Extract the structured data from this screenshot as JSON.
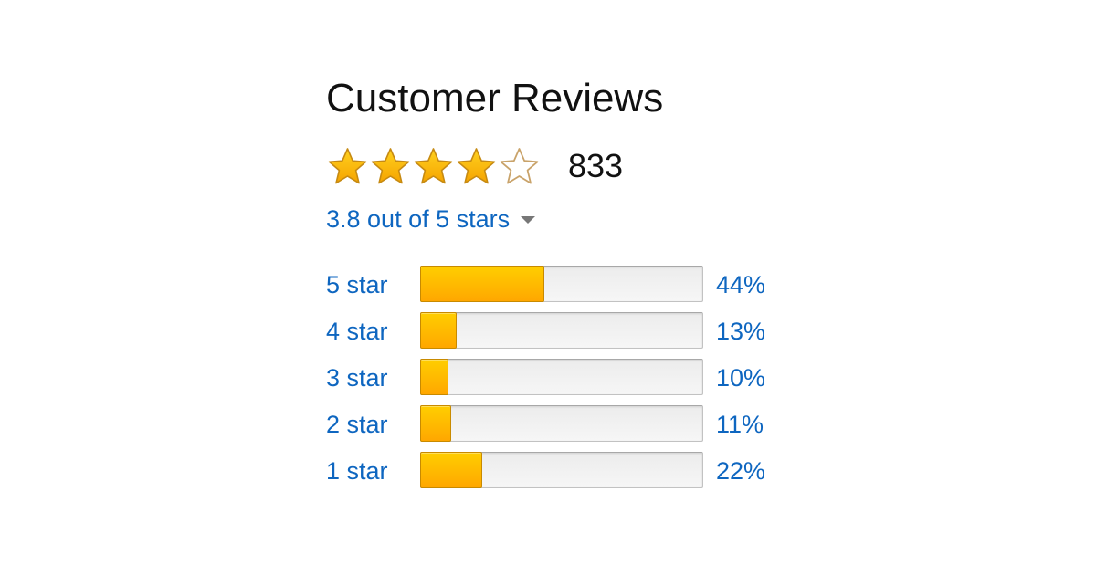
{
  "header": {
    "title": "Customer Reviews"
  },
  "rating": {
    "average": 3.8,
    "max": 5,
    "stars_filled": 4,
    "review_count": "833",
    "summary_link": "3.8 out of 5 stars",
    "star_icons": [
      "star-full-icon",
      "star-full-icon",
      "star-full-icon",
      "star-full-icon",
      "star-empty-icon"
    ]
  },
  "histogram": [
    {
      "label": "5 star",
      "percent_label": "44%",
      "percent": 44
    },
    {
      "label": "4 star",
      "percent_label": "13%",
      "percent": 13
    },
    {
      "label": "3 star",
      "percent_label": "10%",
      "percent": 10
    },
    {
      "label": "2 star",
      "percent_label": "11%",
      "percent": 11
    },
    {
      "label": "1 star",
      "percent_label": "22%",
      "percent": 22
    }
  ],
  "colors": {
    "link": "#0e66c0",
    "bar_fill_top": "#ffce00",
    "bar_fill_bottom": "#ffa700",
    "star_fill": "#ffb900",
    "star_outline": "#c9a36a"
  }
}
